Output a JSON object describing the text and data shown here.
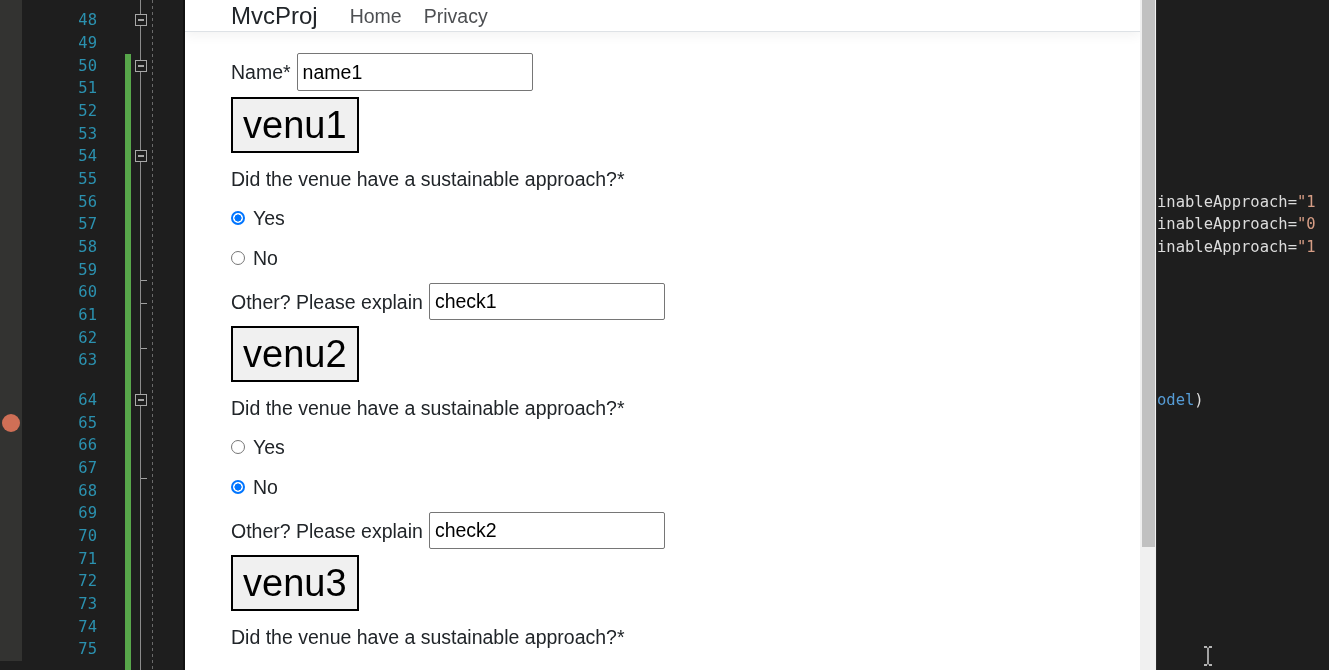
{
  "editor": {
    "blocks": [
      {
        "changed": false,
        "lines": [
          {
            "kind": "code",
            "number": "48",
            "collapsible": true,
            "fold_end": false,
            "breakpoint": false
          },
          {
            "kind": "code",
            "number": "49",
            "collapsible": false,
            "fold_end": false,
            "breakpoint": false
          }
        ]
      },
      {
        "changed": true,
        "lines": [
          {
            "kind": "code",
            "number": "50",
            "collapsible": true,
            "fold_end": false,
            "breakpoint": false
          },
          {
            "kind": "code",
            "number": "51",
            "collapsible": false,
            "fold_end": false,
            "breakpoint": false
          },
          {
            "kind": "code",
            "number": "52",
            "collapsible": false,
            "fold_end": false,
            "breakpoint": false
          },
          {
            "kind": "code",
            "number": "53",
            "collapsible": false,
            "fold_end": false,
            "breakpoint": false
          },
          {
            "kind": "code",
            "number": "54",
            "collapsible": true,
            "fold_end": false,
            "breakpoint": false
          },
          {
            "kind": "code",
            "number": "55",
            "collapsible": false,
            "fold_end": false,
            "breakpoint": false
          },
          {
            "kind": "code",
            "number": "56",
            "collapsible": false,
            "fold_end": false,
            "breakpoint": false,
            "code": [
              {
                "kind": "name",
                "text": "inableApproach"
              },
              {
                "kind": "operator",
                "text": "="
              },
              {
                "kind": "string",
                "text": "\"1"
              }
            ]
          },
          {
            "kind": "code",
            "number": "57",
            "collapsible": false,
            "fold_end": false,
            "breakpoint": false,
            "code": [
              {
                "kind": "name",
                "text": "inableApproach"
              },
              {
                "kind": "operator",
                "text": "="
              },
              {
                "kind": "string",
                "text": "\"0"
              }
            ]
          },
          {
            "kind": "code",
            "number": "58",
            "collapsible": false,
            "fold_end": false,
            "breakpoint": false,
            "code": [
              {
                "kind": "name",
                "text": "inableApproach"
              },
              {
                "kind": "operator",
                "text": "="
              },
              {
                "kind": "string",
                "text": "\"1"
              }
            ]
          },
          {
            "kind": "code",
            "number": "59",
            "collapsible": false,
            "fold_end": true,
            "breakpoint": false
          },
          {
            "kind": "code",
            "number": "60",
            "collapsible": false,
            "fold_end": true,
            "breakpoint": false
          },
          {
            "kind": "code",
            "number": "61",
            "collapsible": false,
            "fold_end": false,
            "breakpoint": false
          },
          {
            "kind": "code",
            "number": "62",
            "collapsible": false,
            "fold_end": true,
            "breakpoint": false
          },
          {
            "kind": "code",
            "number": "63",
            "collapsible": false,
            "fold_end": false,
            "breakpoint": false
          },
          {
            "kind": "codelens"
          },
          {
            "kind": "code",
            "number": "64",
            "collapsible": true,
            "fold_end": false,
            "breakpoint": false,
            "code": [
              {
                "kind": "identifier",
                "text": "odel"
              },
              {
                "kind": "punctuation",
                "text": ")"
              }
            ]
          },
          {
            "kind": "code",
            "number": "65",
            "collapsible": false,
            "fold_end": false,
            "breakpoint": true
          },
          {
            "kind": "code",
            "number": "66",
            "collapsible": false,
            "fold_end": false,
            "breakpoint": false
          },
          {
            "kind": "code",
            "number": "67",
            "collapsible": false,
            "fold_end": true,
            "breakpoint": false
          },
          {
            "kind": "code",
            "number": "68",
            "collapsible": false,
            "fold_end": false,
            "breakpoint": false
          },
          {
            "kind": "code",
            "number": "69",
            "collapsible": false,
            "fold_end": false,
            "breakpoint": false
          },
          {
            "kind": "code",
            "number": "70",
            "collapsible": false,
            "fold_end": false,
            "breakpoint": false
          },
          {
            "kind": "code",
            "number": "71",
            "collapsible": false,
            "fold_end": false,
            "breakpoint": false
          },
          {
            "kind": "code",
            "number": "72",
            "collapsible": false,
            "fold_end": false,
            "breakpoint": false
          },
          {
            "kind": "code",
            "number": "73",
            "collapsible": false,
            "fold_end": false,
            "breakpoint": false
          },
          {
            "kind": "code",
            "number": "74",
            "collapsible": false,
            "fold_end": false,
            "breakpoint": false
          },
          {
            "kind": "code",
            "number": "75",
            "collapsible": false,
            "fold_end": false,
            "breakpoint": false
          }
        ]
      }
    ]
  },
  "browser": {
    "navbar": {
      "brand": "MvcProj",
      "links": [
        "Home",
        "Privacy"
      ]
    },
    "form": {
      "name": {
        "label": "Name*",
        "value": "name1"
      },
      "venues": [
        {
          "title": "venu1",
          "question": "Did the venue have a sustainable approach?*",
          "options": [
            {
              "label": "Yes",
              "selected": true
            },
            {
              "label": "No",
              "selected": false
            }
          ],
          "other": {
            "label": "Other? Please explain",
            "value": "check1"
          }
        },
        {
          "title": "venu2",
          "question": "Did the venue have a sustainable approach?*",
          "options": [
            {
              "label": "Yes",
              "selected": false
            },
            {
              "label": "No",
              "selected": true
            }
          ],
          "other": {
            "label": "Other? Please explain",
            "value": "check2"
          }
        },
        {
          "title": "venu3",
          "question": "Did the venue have a sustainable approach?*"
        }
      ]
    }
  }
}
